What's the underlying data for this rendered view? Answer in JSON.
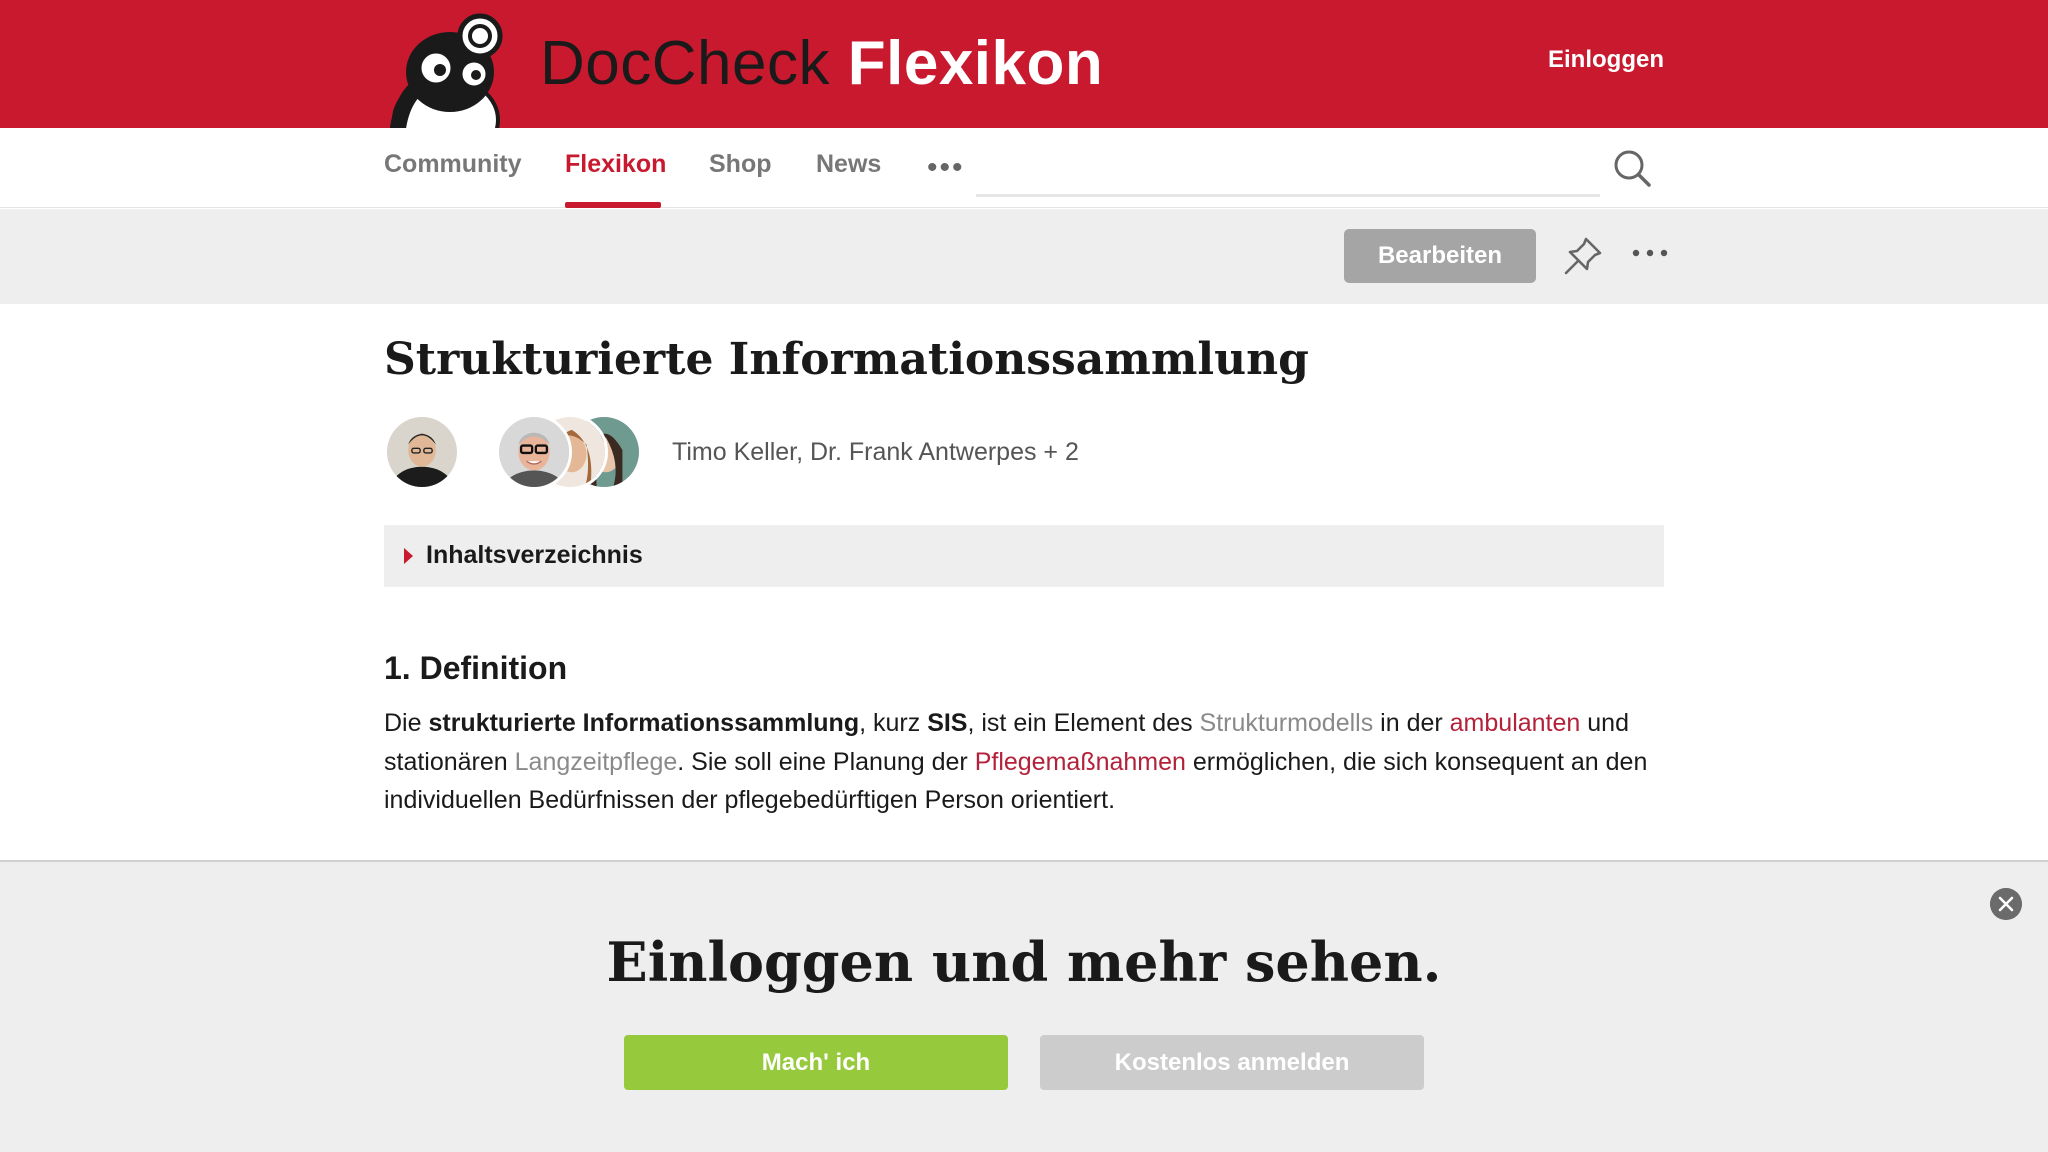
{
  "header": {
    "brand_part1": "DocCheck",
    "brand_part2": "Flexikon",
    "login_label": "Einloggen",
    "logo_icon": "mascot-logo-icon"
  },
  "nav": {
    "items": [
      {
        "label": "Community",
        "active": false
      },
      {
        "label": "Flexikon",
        "active": true
      },
      {
        "label": "Shop",
        "active": false
      },
      {
        "label": "News",
        "active": false
      }
    ],
    "more_label": "•••",
    "search_icon": "search-icon"
  },
  "toolbar": {
    "edit_label": "Bearbeiten",
    "pin_icon": "pin-icon",
    "more_icon": "more-dots-icon"
  },
  "article": {
    "title": "Strukturierte Informationssammlung",
    "authors": "Timo Keller, Dr. Frank Antwerpes + 2",
    "toc_label": "Inhaltsverzeichnis",
    "section_heading": "1. Definition",
    "paragraph": {
      "t1": "Die ",
      "b1": "strukturierte Informationssammlung",
      "t2": ", kurz ",
      "b2": "SIS",
      "t3": ", ist ein Element des ",
      "link1": "Strukturmodells",
      "t4": " in der ",
      "link2": "ambulanten",
      "t5": " und stationären ",
      "link3": "Langzeitpflege",
      "t6": ". Sie soll eine Planung der ",
      "link4": "Pflegemaßnahmen",
      "t7": " ermöglichen, die sich konsequent an den individuellen Bedürfnissen der pflegebedürftigen Person orientiert."
    }
  },
  "login_overlay": {
    "title": "Einloggen und mehr sehen.",
    "primary_label": "Mach' ich",
    "secondary_label": "Kostenlos anmelden",
    "close_icon": "close-icon"
  },
  "colors": {
    "brand_red": "#c8192f",
    "link_red": "#b3213a",
    "link_grey": "#8a8a8a",
    "green": "#97c93c",
    "grey_button": "#a5a5a5"
  }
}
